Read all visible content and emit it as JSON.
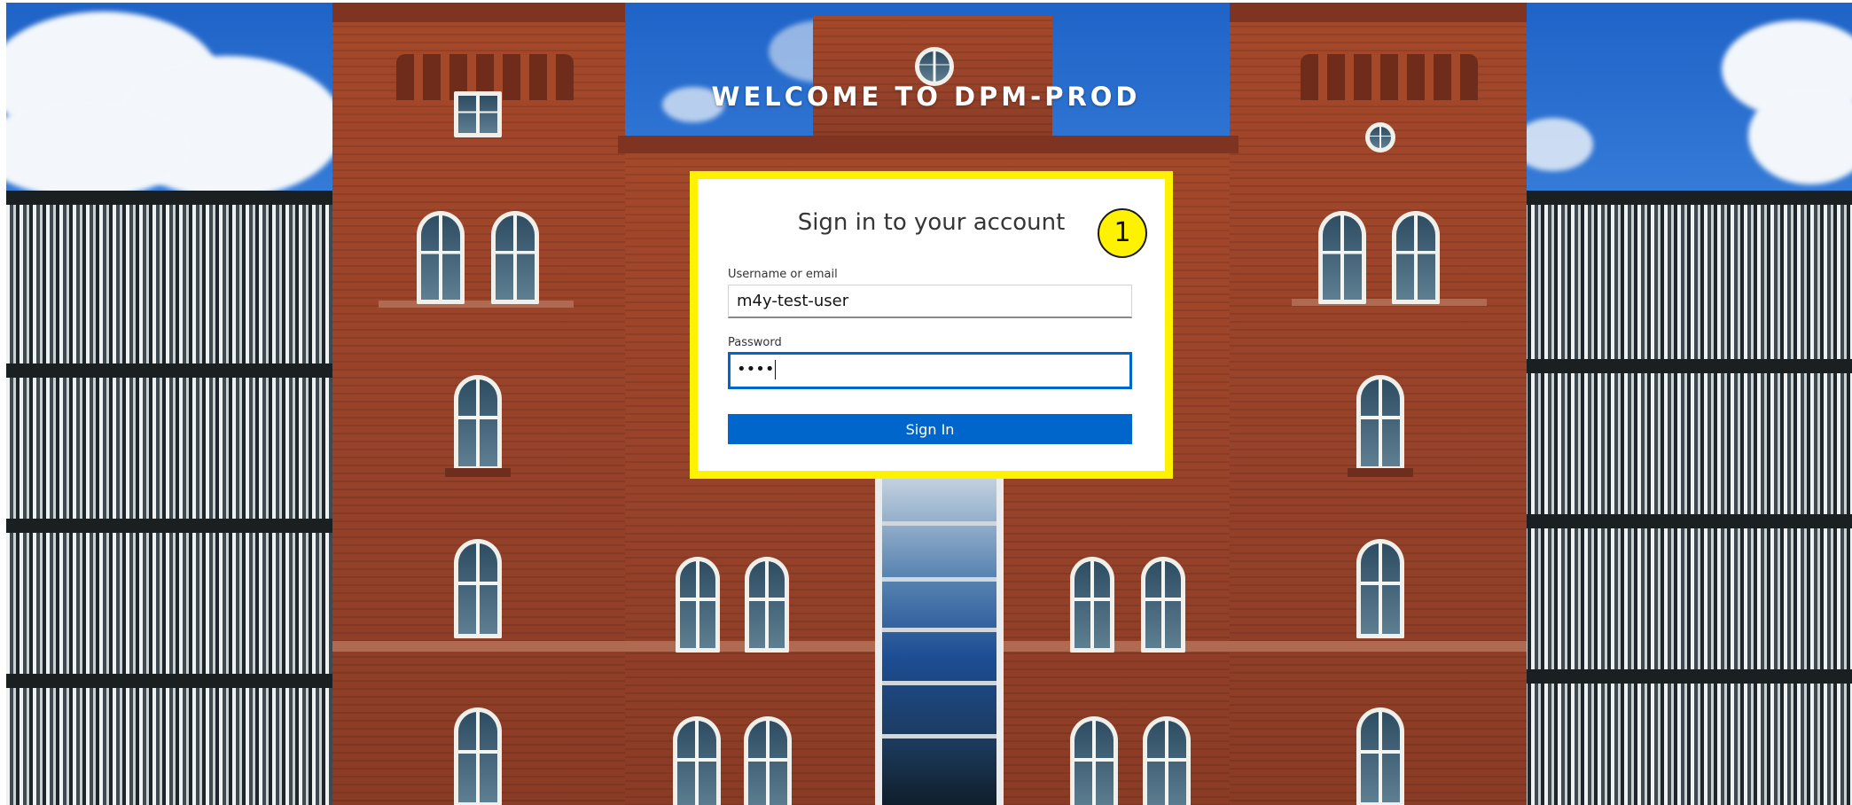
{
  "page": {
    "welcome_title": "WELCOME TO DPM-PROD"
  },
  "login": {
    "title": "Sign in to your account",
    "username_label": "Username or email",
    "username_value": "m4y-test-user",
    "password_label": "Password",
    "password_masked": "••••",
    "submit_label": "Sign In"
  },
  "annotation": {
    "step_number": "1"
  },
  "colors": {
    "highlight": "#fff200",
    "primary": "#0066cc"
  }
}
